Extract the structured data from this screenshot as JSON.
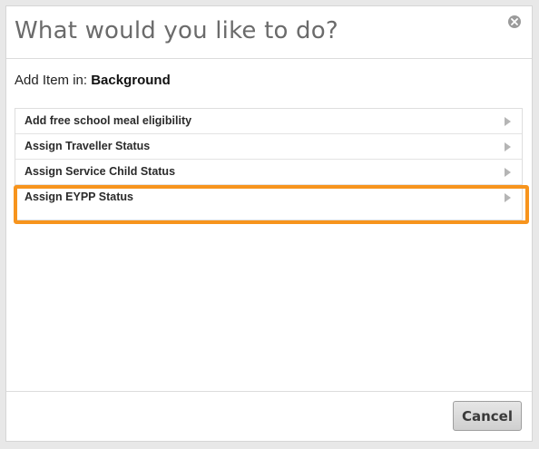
{
  "dialog": {
    "title": "What would you like to do?",
    "close_icon": "close-icon"
  },
  "context": {
    "label": "Add Item in:",
    "value": "Background"
  },
  "items": [
    {
      "label": "Add free school meal eligibility",
      "icon": "arrow-right-icon"
    },
    {
      "label": "Assign Traveller Status",
      "icon": "arrow-right-icon"
    },
    {
      "label": "Assign Service Child Status",
      "icon": "arrow-right-icon"
    },
    {
      "label": "Assign EYPP Status",
      "icon": "arrow-right-icon",
      "highlighted": true
    }
  ],
  "footer": {
    "cancel_label": "Cancel"
  },
  "colors": {
    "highlight": "#f7941d",
    "title": "#6b6b6b"
  }
}
